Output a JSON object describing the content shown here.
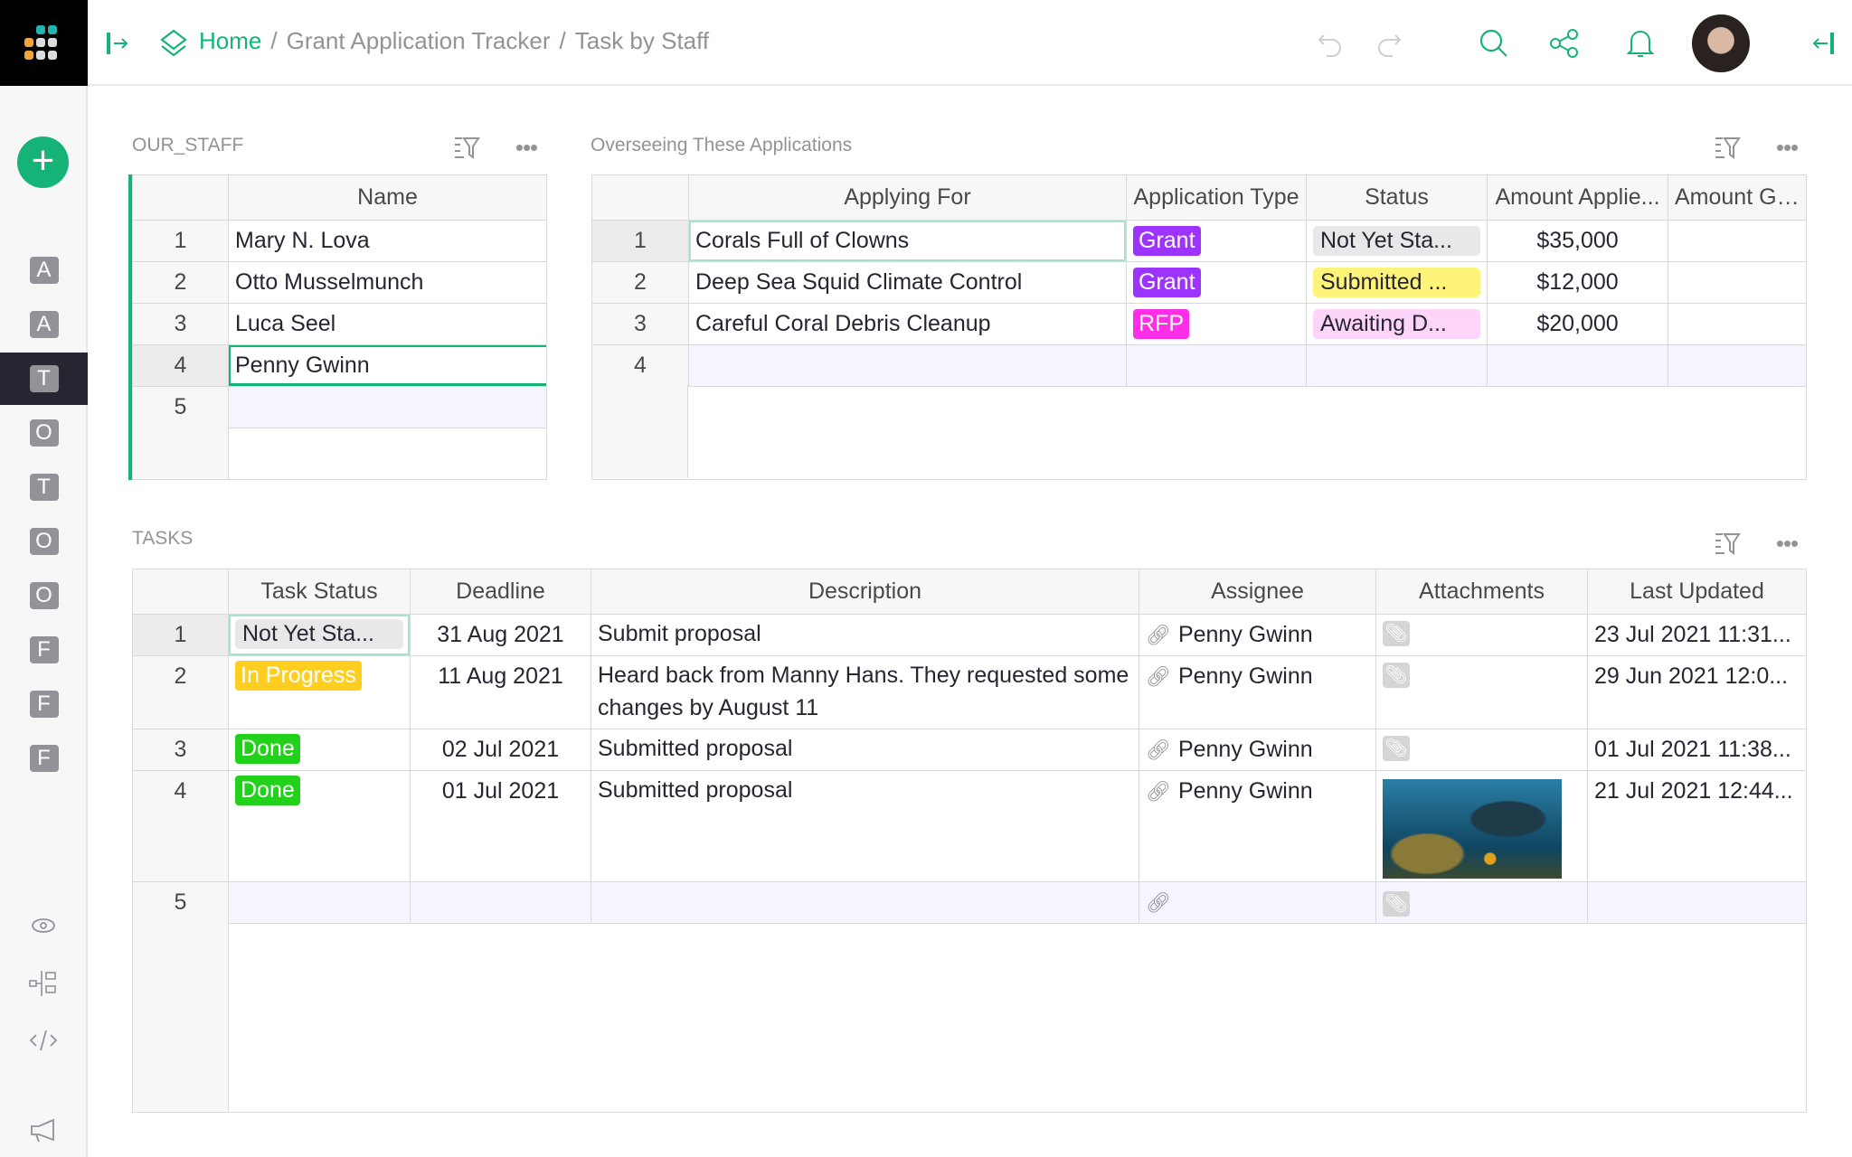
{
  "breadcrumb": {
    "home": "Home",
    "doc": "Grant Application Tracker",
    "page": "Task by Staff"
  },
  "sidebar": {
    "pages": [
      "A",
      "A",
      "T",
      "O",
      "T",
      "O",
      "O",
      "F",
      "F",
      "F"
    ],
    "active_index": 2
  },
  "colors": {
    "accent": "#16b378",
    "grant": "#9c33ff",
    "rfp": "#ff2ee6",
    "not_started": "#e8e8e8",
    "submitted": "#fff47a",
    "awaiting": "#fdd5fa",
    "in_progress": "#ffce1f",
    "done": "#22d11a"
  },
  "staff": {
    "title": "OUR_STAFF",
    "column": "Name",
    "rows": [
      {
        "n": "1",
        "name": "Mary N. Lova"
      },
      {
        "n": "2",
        "name": "Otto Musselmunch"
      },
      {
        "n": "3",
        "name": "Luca Seel"
      },
      {
        "n": "4",
        "name": "Penny Gwinn"
      }
    ],
    "new_row": "5"
  },
  "apps": {
    "title": "Overseeing These Applications",
    "columns": [
      "Applying For",
      "Application Type",
      "Status",
      "Amount Applie...",
      "Amount Grar"
    ],
    "rows": [
      {
        "n": "1",
        "for": "Corals Full of Clowns",
        "type": "Grant",
        "status": "Not Yet Sta...",
        "amount": "$35,000"
      },
      {
        "n": "2",
        "for": "Deep Sea Squid Climate Control",
        "type": "Grant",
        "status": "Submitted ...",
        "amount": "$12,000"
      },
      {
        "n": "3",
        "for": "Careful Coral Debris Cleanup",
        "type": "RFP",
        "status": "Awaiting D...",
        "amount": "$20,000"
      }
    ],
    "new_row": "4"
  },
  "tasks": {
    "title": "TASKS",
    "columns": [
      "Task Status",
      "Deadline",
      "Description",
      "Assignee",
      "Attachments",
      "Last Updated"
    ],
    "rows": [
      {
        "n": "1",
        "status": "Not Yet Sta...",
        "deadline": "31 Aug 2021",
        "desc": "Submit proposal",
        "assignee": "Penny Gwinn",
        "updated": "23 Jul 2021 11:31..."
      },
      {
        "n": "2",
        "status": "In Progress",
        "deadline": "11 Aug 2021",
        "desc": "Heard back from Manny Hans. They requested some changes by August 11",
        "assignee": "Penny Gwinn",
        "updated": "29 Jun 2021 12:0..."
      },
      {
        "n": "3",
        "status": "Done",
        "deadline": "02 Jul 2021",
        "desc": "Submitted proposal",
        "assignee": "Penny Gwinn",
        "updated": "01 Jul 2021 11:38..."
      },
      {
        "n": "4",
        "status": "Done",
        "deadline": "01 Jul 2021",
        "desc": "Submitted proposal",
        "assignee": "Penny Gwinn",
        "updated": "21 Jul 2021 12:44..."
      }
    ],
    "new_row": "5"
  }
}
